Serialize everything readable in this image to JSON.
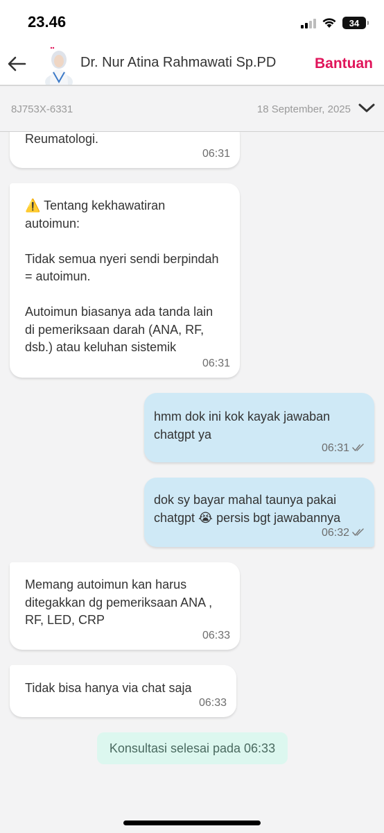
{
  "status_bar": {
    "time": "23.46",
    "battery": "34"
  },
  "header": {
    "doctor_name": "Dr. Nur Atina Rahmawati Sp.PD",
    "help_label": "Bantuan"
  },
  "consultation": {
    "id": "8J753X-6331",
    "date": "18 September, 2025"
  },
  "messages": [
    {
      "from": "doctor",
      "text": "Reumatologi.",
      "time": "06:31"
    },
    {
      "from": "doctor",
      "text": "⚠️ Tentang kekhawatiran\nautoimun:\n\nTidak semua nyeri sendi berpindah\n= autoimun.\n\nAutoimun biasanya ada tanda lain\ndi pemeriksaan darah (ANA, RF,\ndsb.) atau keluhan sistemik",
      "time": "06:31"
    },
    {
      "from": "patient",
      "text": "hmm dok ini kok kayak jawaban\nchatgpt ya",
      "time": "06:31",
      "read": true
    },
    {
      "from": "patient",
      "text": "dok sy bayar mahal taunya pakai\nchatgpt 😭 persis bgt jawabannya",
      "time": "06:32",
      "read": true
    },
    {
      "from": "doctor",
      "text": "Memang autoimun kan harus\nditegakkan dg pemeriksaan ANA ,\nRF, LED, CRP",
      "time": "06:33"
    },
    {
      "from": "doctor",
      "text": "Tidak bisa hanya via chat saja",
      "time": "06:33"
    }
  ],
  "end_notice": "Konsultasi selesai pada 06:33",
  "colors": {
    "accent": "#e0145a",
    "incoming_bubble": "#ffffff",
    "outgoing_bubble": "#cfe9f6",
    "end_badge": "#dcf7ef"
  }
}
